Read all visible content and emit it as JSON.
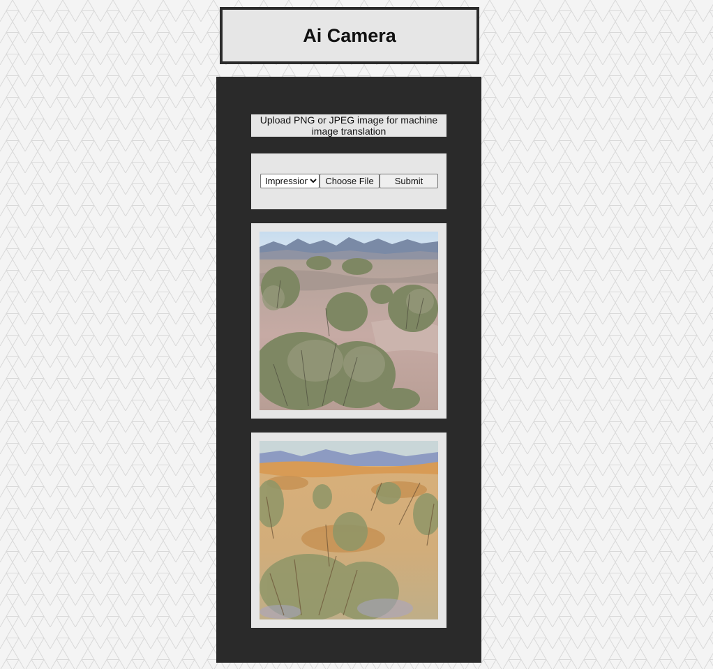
{
  "header": {
    "title": "Ai Camera"
  },
  "upload": {
    "instructions": "Upload PNG or JPEG image for machine image translation",
    "style_selected": "Impressionism",
    "choose_file_label": "Choose File",
    "submit_label": "Submit"
  },
  "colors": {
    "panel_background": "#2a2a2a",
    "card_background": "#e6e6e6",
    "page_background": "#f4f4f4"
  },
  "images": [
    {
      "name": "input-desert-photo"
    },
    {
      "name": "output-impressionist-painting"
    }
  ]
}
